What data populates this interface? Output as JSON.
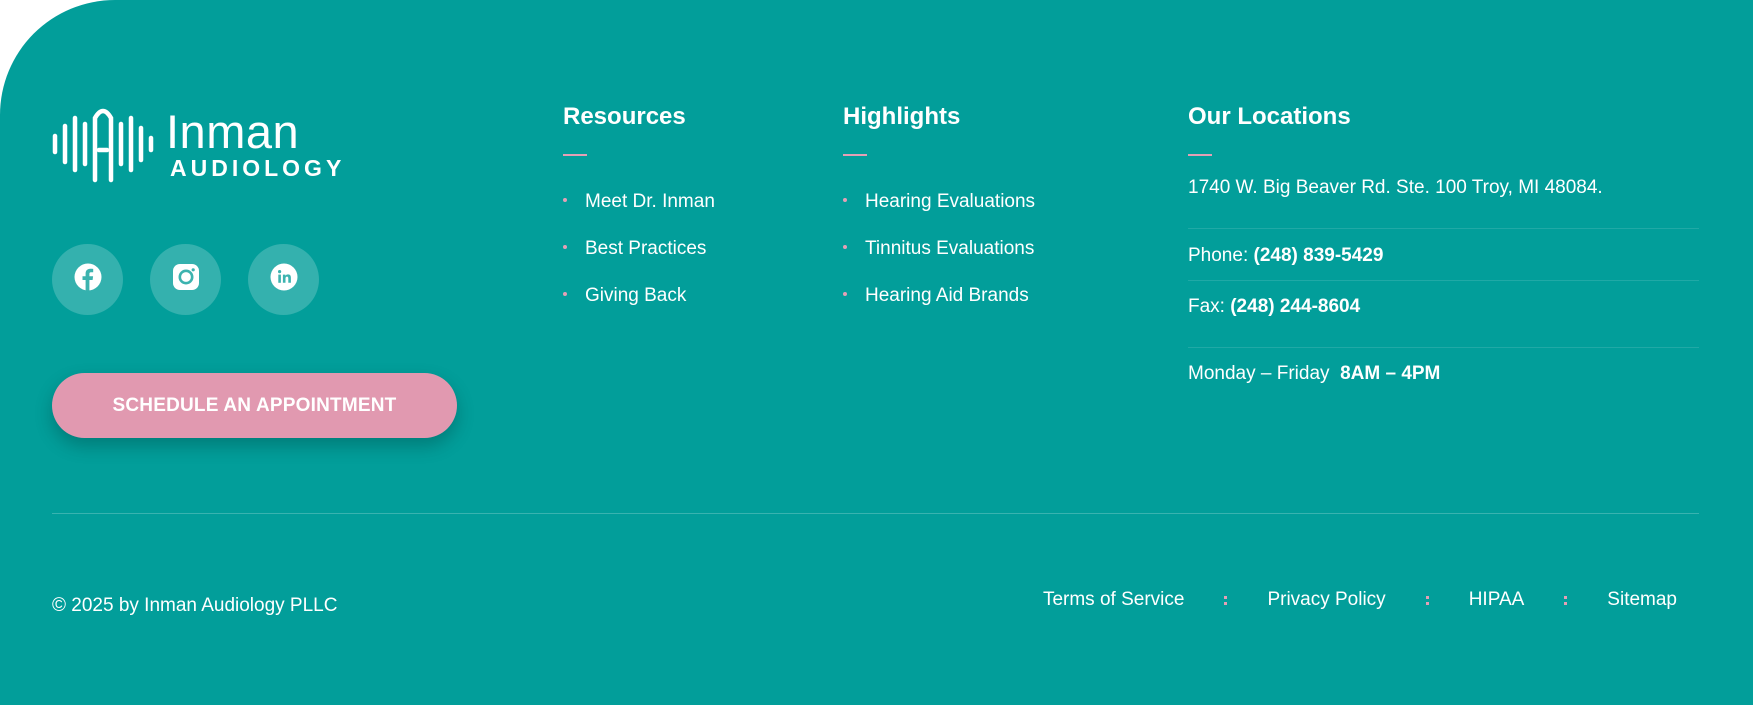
{
  "brand": {
    "name": "Inman",
    "subtitle": "AUDIOLOGY",
    "logo_icon": "sound-wave-icon"
  },
  "social": [
    {
      "icon": "facebook-icon"
    },
    {
      "icon": "instagram-icon"
    },
    {
      "icon": "linkedin-icon"
    }
  ],
  "cta": {
    "label": "SCHEDULE AN APPOINTMENT"
  },
  "resources": {
    "title": "Resources",
    "items": [
      "Meet Dr. Inman",
      "Best Practices",
      "Giving Back"
    ]
  },
  "highlights": {
    "title": "Highlights",
    "items": [
      "Hearing Evaluations",
      "Tinnitus Evaluations",
      "Hearing Aid Brands"
    ]
  },
  "locations": {
    "title": "Our Locations",
    "address": "1740 W. Big Beaver Rd. Ste. 100 Troy, MI 48084.",
    "phone_label": "Phone:",
    "phone": "(248) 839-5429",
    "fax_label": "Fax:",
    "fax": "(248) 244-8604",
    "hours_label": "Monday – Friday",
    "hours": "8AM – 4PM"
  },
  "footer": {
    "copyright": "© 2025 by Inman Audiology PLLC",
    "links": [
      "Terms of Service",
      "Privacy Policy",
      "HIPAA",
      "Sitemap"
    ]
  },
  "colors": {
    "background": "#029e9a",
    "accent_pink": "#e199b0",
    "text": "#ffffff"
  }
}
